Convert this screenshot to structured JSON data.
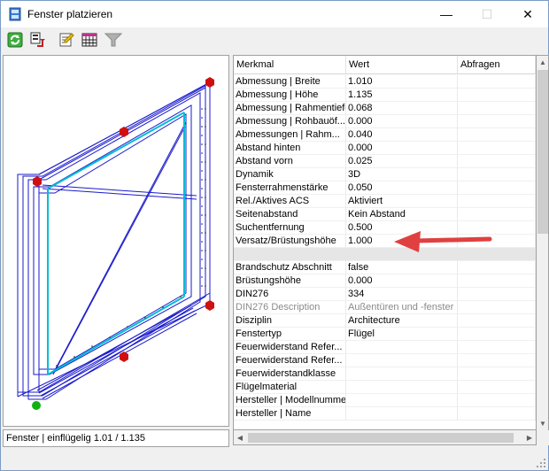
{
  "window": {
    "title": "Fenster platzieren",
    "minimize_glyph": "—",
    "maximize_glyph": "☐",
    "close_glyph": "✕"
  },
  "toolbar": {
    "buttons": [
      {
        "name": "refresh-icon"
      },
      {
        "name": "copy-settings-icon"
      },
      {
        "name": "edit-icon"
      },
      {
        "name": "table-icon"
      },
      {
        "name": "filter-icon"
      }
    ]
  },
  "preview": {
    "status": "Fenster | einflügelig  1.01 / 1.135"
  },
  "grid": {
    "headers": [
      "Merkmal",
      "Wert",
      "Abfragen"
    ],
    "rows": [
      {
        "merkmal": "Abmessung | Breite",
        "wert": "1.010"
      },
      {
        "merkmal": "Abmessung | Höhe",
        "wert": "1.135"
      },
      {
        "merkmal": "Abmessung | Rahmentiefe",
        "wert": "0.068"
      },
      {
        "merkmal": "Abmessung | Rohbauöf...",
        "wert": "0.000"
      },
      {
        "merkmal": "Abmessungen | Rahm...",
        "wert": "0.040"
      },
      {
        "merkmal": "Abstand hinten",
        "wert": "0.000"
      },
      {
        "merkmal": "Abstand vorn",
        "wert": "0.025"
      },
      {
        "merkmal": "Dynamik",
        "wert": "3D"
      },
      {
        "merkmal": "Fensterrahmenstärke",
        "wert": "0.050"
      },
      {
        "merkmal": "Rel./Aktives ACS",
        "wert": "Aktiviert"
      },
      {
        "merkmal": "Seitenabstand",
        "wert": "Kein Abstand"
      },
      {
        "merkmal": "Suchentfernung",
        "wert": "0.500"
      },
      {
        "merkmal": "Versatz/Brüstungshöhe",
        "wert": "1.000"
      },
      {
        "merkmal": "",
        "wert": "",
        "separator": true
      },
      {
        "merkmal": "Brandschutz Abschnitt",
        "wert": "false"
      },
      {
        "merkmal": "Brüstungshöhe",
        "wert": "0.000"
      },
      {
        "merkmal": "DIN276",
        "wert": "334"
      },
      {
        "merkmal": "DIN276 Description",
        "wert": "Außentüren und -fenster",
        "disabled": true
      },
      {
        "merkmal": "Disziplin",
        "wert": "Architecture"
      },
      {
        "merkmal": "Fenstertyp",
        "wert": "Flügel"
      },
      {
        "merkmal": "Feuerwiderstand Refer...",
        "wert": ""
      },
      {
        "merkmal": "Feuerwiderstand Refer...",
        "wert": ""
      },
      {
        "merkmal": "Feuerwiderstandklasse",
        "wert": ""
      },
      {
        "merkmal": "Flügelmaterial",
        "wert": ""
      },
      {
        "merkmal": "Hersteller | Modellnummer",
        "wert": ""
      },
      {
        "merkmal": "Hersteller | Name",
        "wert": ""
      }
    ]
  },
  "colors": {
    "annotation_arrow": "#e04040",
    "window_frame": "#1a1acc",
    "glass": "#00bcd4",
    "grip_point": "#d01010",
    "base_point": "#10b010"
  }
}
